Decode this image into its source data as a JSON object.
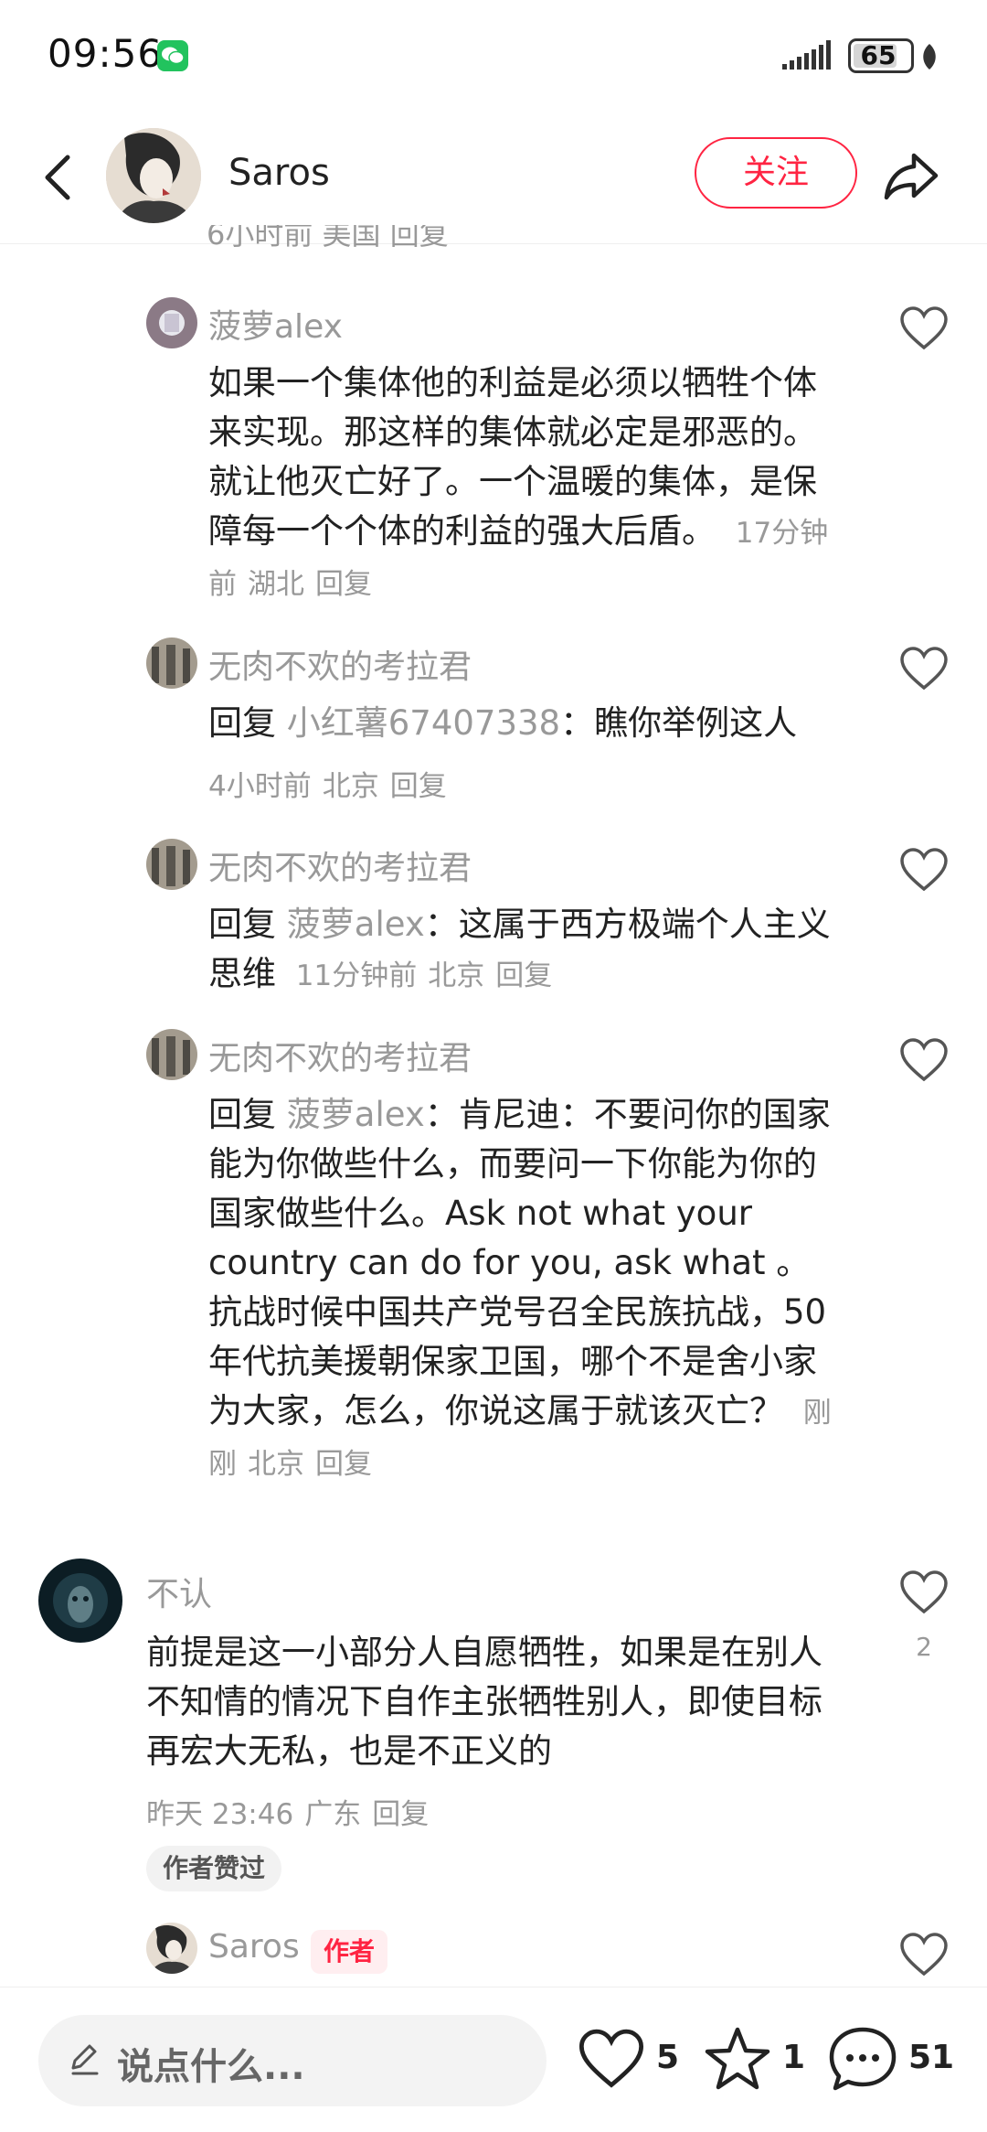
{
  "status_bar": {
    "time": "09:56",
    "battery": "65"
  },
  "header": {
    "name": "Saros",
    "follow_label": "关注",
    "clipped_meta": "6小时前 美国 回复"
  },
  "comments": [
    {
      "user": "菠萝alex",
      "text": "如果一个集体他的利益是必须以牺牲个体来实现。那这样的集体就必定是邪恶的。就让他灭亡好了。一个温暖的集体，是保障每一个个体的利益的强大后盾。",
      "time": "17分钟前",
      "location": "湖北",
      "reply": "回复"
    },
    {
      "user": "无肉不欢的考拉君",
      "reply_word": "回复",
      "target": "小红薯67407338",
      "text": "：瞧你举例这人",
      "time": "4小时前",
      "location": "北京",
      "reply": "回复"
    },
    {
      "user": "无肉不欢的考拉君",
      "reply_word": "回复",
      "target": "菠萝alex",
      "text": "：这属于西方极端个人主义思维",
      "time": "11分钟前",
      "location": "北京",
      "reply": "回复"
    },
    {
      "user": "无肉不欢的考拉君",
      "reply_word": "回复",
      "target": "菠萝alex",
      "text": "：肯尼迪：不要问你的国家能为你做些什么，而要问一下你能为你的国家做些什么。Ask not what your country can do for you, ask what 。抗战时候中国共产党号召全民族抗战，50年代抗美援朝保家卫国，哪个不是舍小家为大家，怎么，你说这属于就该灭亡？",
      "time": "刚刚",
      "location": "北京",
      "reply": "回复"
    },
    {
      "user": "不认",
      "text": "前提是这一小部分人自愿牺牲，如果是在别人不知情的情况下自作主张牺牲别人，即使目标再宏大无私，也是不正义的",
      "time": "昨天 23:46",
      "location": "广东",
      "reply": "回复",
      "likes": "2",
      "author_liked": "作者赞过"
    },
    {
      "user": "Saros",
      "badge": "作者"
    }
  ],
  "bottom_bar": {
    "placeholder": "说点什么...",
    "likes": "5",
    "collects": "1",
    "comments": "51"
  }
}
